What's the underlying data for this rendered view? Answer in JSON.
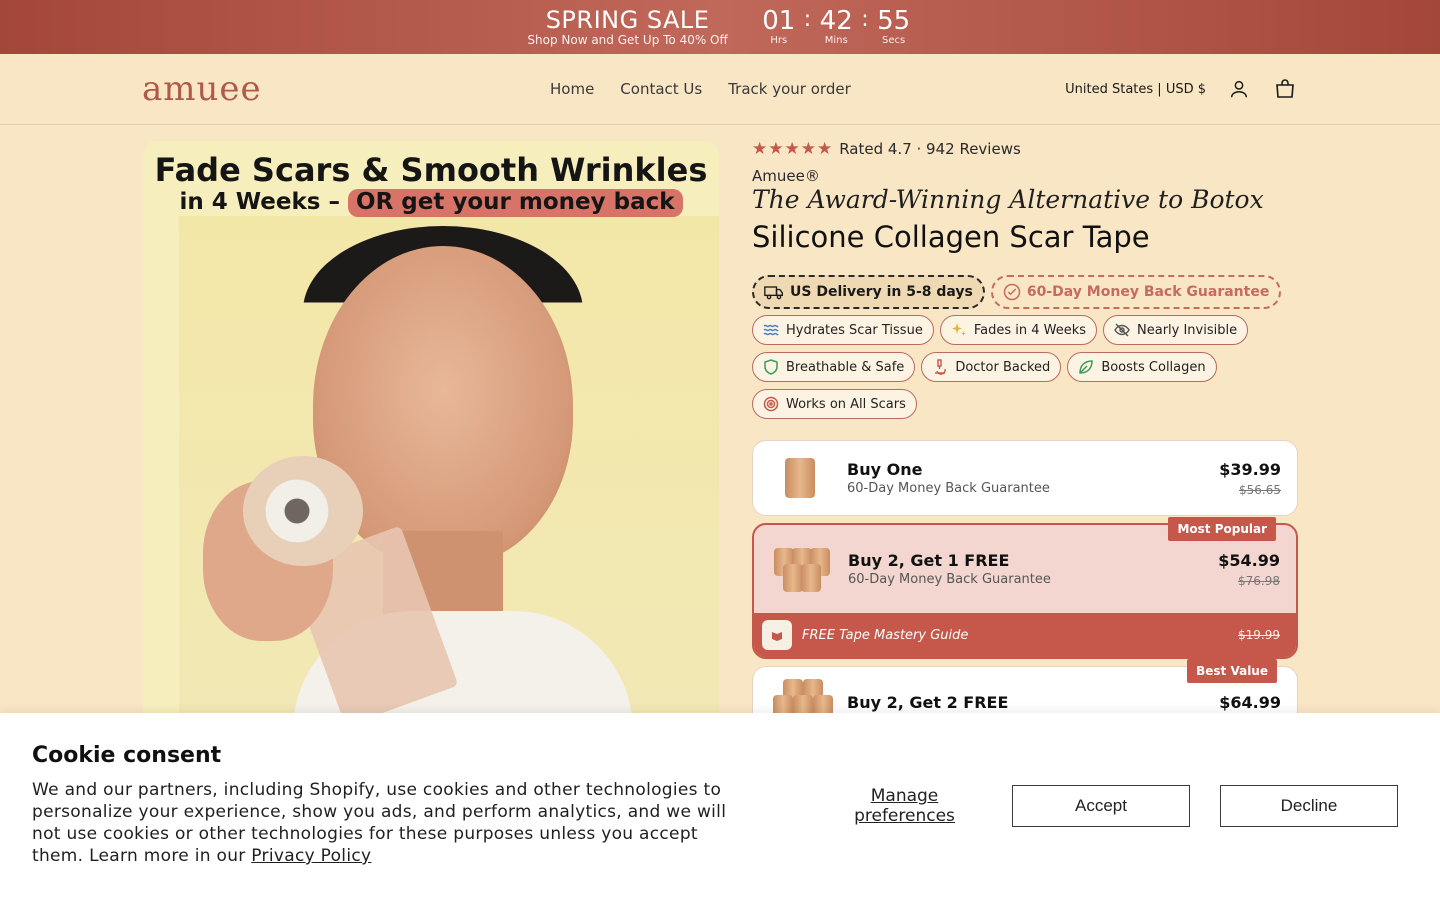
{
  "announcement": {
    "title": "SPRING SALE",
    "subtitle": "Shop Now and Get Up To 40% Off",
    "timer": [
      {
        "value": "01",
        "label": "Hrs"
      },
      {
        "value": "42",
        "label": "Mins"
      },
      {
        "value": "55",
        "label": "Secs"
      }
    ],
    "separator": ":"
  },
  "header": {
    "logo": "amuee",
    "nav": [
      "Home",
      "Contact Us",
      "Track your order"
    ],
    "locale": "United States | USD $"
  },
  "hero": {
    "headline": "Fade Scars & Smooth Wrinkles",
    "subhead_prefix": "in 4 Weeks –",
    "subhead_highlight": "OR get your money back"
  },
  "product": {
    "rating_value": 4.7,
    "rating_text": "Rated 4.7 · 942 Reviews",
    "stars": "★★★★★",
    "brand": "Amuee®",
    "subtitle": "The Award-Winning Alternative to Botox",
    "title": "Silicone Collagen Scar Tape",
    "guarantees": [
      "US Delivery in 5-8 days",
      "60-Day Money Back Guarantee"
    ],
    "features": [
      {
        "label": "Hydrates Scar Tissue",
        "icon": "waves-icon",
        "color": "#4a7fc1"
      },
      {
        "label": "Fades in 4 Weeks",
        "icon": "sparkle-icon",
        "color": "#e0b43a"
      },
      {
        "label": "Nearly Invisible",
        "icon": "eye-off-icon",
        "color": "#555555"
      },
      {
        "label": "Breathable & Safe",
        "icon": "shield-icon",
        "color": "#3c9a5f"
      },
      {
        "label": "Doctor Backed",
        "icon": "microscope-icon",
        "color": "#c6584b"
      },
      {
        "label": "Boosts Collagen",
        "icon": "leaf-icon",
        "color": "#3c9a5f"
      },
      {
        "label": "Works on All Scars",
        "icon": "target-icon",
        "color": "#c6584b"
      }
    ],
    "offers": [
      {
        "title": "Buy One",
        "sub": "60-Day Money Back Guarantee",
        "price": "$39.99",
        "was": "$56.65"
      },
      {
        "title": "Buy 2, Get 1 FREE",
        "sub": "60-Day Money Back Guarantee",
        "price": "$54.99",
        "was": "$76.98",
        "badge": "Most Popular",
        "gift": "FREE Tape Mastery Guide",
        "gift_was": "$19.99"
      },
      {
        "title": "Buy 2, Get 2 FREE",
        "price": "$64.99",
        "badge": "Best Value"
      }
    ]
  },
  "cookie": {
    "title": "Cookie consent",
    "text": "We and our partners, including Shopify, use cookies and other technologies to personalize your experience, show you ads, and perform analytics, and we will not use cookies or other technologies for these purposes unless you accept them. Learn more in our ",
    "link": "Privacy Policy",
    "manage": "Manage preferences",
    "accept": "Accept",
    "decline": "Decline"
  },
  "colors": {
    "accent": "#c6584b",
    "background": "#f9e6c5",
    "banner": "#a4473a"
  }
}
